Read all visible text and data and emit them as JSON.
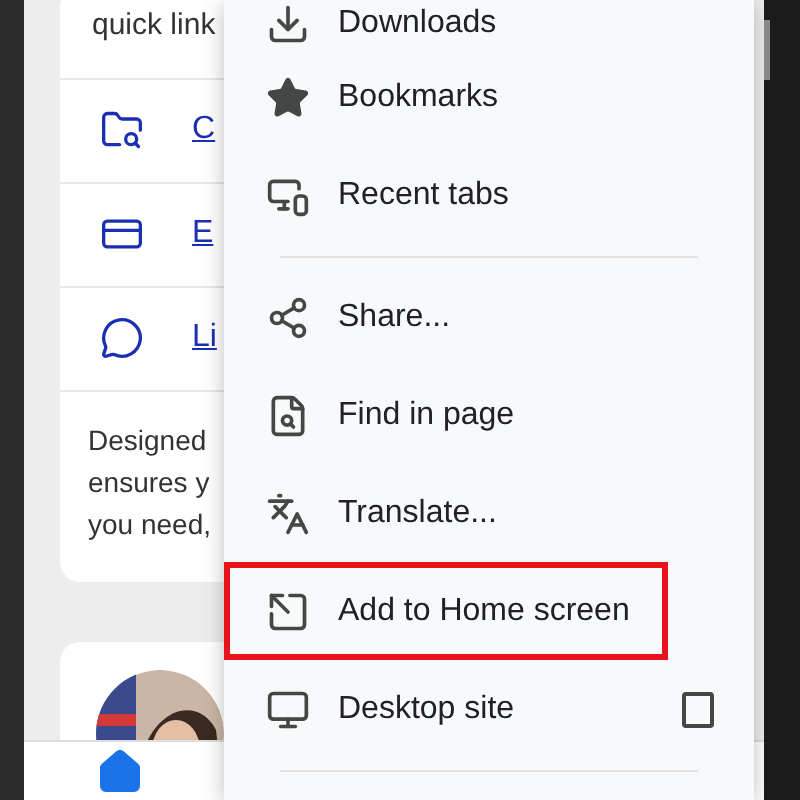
{
  "page_card": {
    "intro_line": "quick link",
    "links": [
      {
        "label": "C"
      },
      {
        "label": "E"
      },
      {
        "label": "Li"
      }
    ],
    "description_lines": [
      "Designed",
      "ensures y",
      "you need,"
    ]
  },
  "bottom_nav": {
    "home_selected": true
  },
  "menu": [
    {
      "kind": "item",
      "label": "Downloads",
      "highlighted": false
    },
    {
      "kind": "item",
      "label": "Bookmarks",
      "highlighted": false
    },
    {
      "kind": "item",
      "label": "Recent tabs",
      "highlighted": false
    },
    {
      "kind": "divider"
    },
    {
      "kind": "item",
      "label": "Share...",
      "highlighted": false
    },
    {
      "kind": "item",
      "label": "Find in page",
      "highlighted": false
    },
    {
      "kind": "item",
      "label": "Translate...",
      "highlighted": false
    },
    {
      "kind": "item",
      "label": "Add to Home screen",
      "highlighted": true
    },
    {
      "kind": "checkbox",
      "label": "Desktop site",
      "checked": false,
      "highlighted": false
    },
    {
      "kind": "divider"
    }
  ]
}
